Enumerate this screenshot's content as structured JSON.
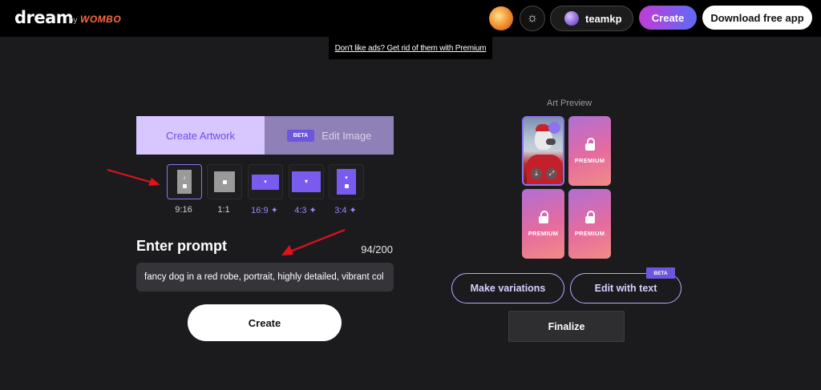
{
  "header": {
    "logo": "dream",
    "logo_by": "by",
    "logo_brand": "WOMBO",
    "username": "teamkp",
    "create_label": "Create",
    "download_label": "Download free app",
    "theme_icon": "sun-icon"
  },
  "ad": {
    "text": "Don't like ads? Get rid of them with Premium"
  },
  "editor": {
    "tabs": {
      "create": "Create Artwork",
      "edit": "Edit Image",
      "edit_badge": "BETA"
    },
    "aspect_ratios": [
      {
        "label": "9:16",
        "premium": false,
        "selected": true
      },
      {
        "label": "1:1",
        "premium": false,
        "selected": false
      },
      {
        "label": "16:9 ✦",
        "premium": true,
        "selected": false
      },
      {
        "label": "4:3 ✦",
        "premium": true,
        "selected": false
      },
      {
        "label": "3:4 ✦",
        "premium": true,
        "selected": false
      }
    ],
    "prompt_heading": "Enter prompt",
    "char_count": "94/200",
    "prompt_value": "fancy dog in a red robe, portrait, highly detailed, vibrant col",
    "create_label": "Create"
  },
  "preview": {
    "label": "Art Preview",
    "premium_label": "PREMIUM",
    "variations_label": "Make variations",
    "edit_text_label": "Edit with text",
    "edit_text_badge": "BETA",
    "finalize_label": "Finalize"
  },
  "colors": {
    "accent": "#8a74f0",
    "tab_active_bg": "#d7c6ff",
    "arrow": "#e0121b"
  }
}
